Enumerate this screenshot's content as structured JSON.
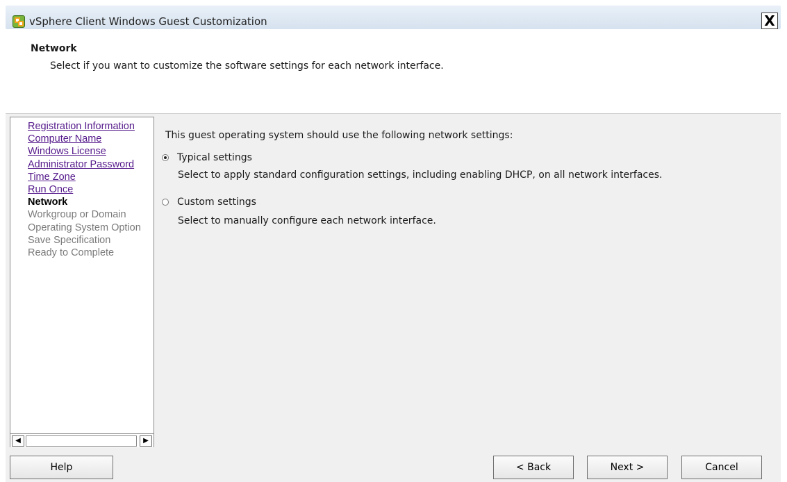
{
  "window": {
    "title": "vSphere Client Windows Guest Customization",
    "close_label": "X",
    "app_icon": "vsphere-icon"
  },
  "header": {
    "title": "Network",
    "description": "Select if you want to customize the software settings for each network interface."
  },
  "sidebar": {
    "steps": [
      {
        "label": "Registration Information",
        "state": "completed"
      },
      {
        "label": "Computer Name",
        "state": "completed"
      },
      {
        "label": "Windows License",
        "state": "completed"
      },
      {
        "label": "Administrator Password",
        "state": "completed"
      },
      {
        "label": "Time Zone",
        "state": "completed"
      },
      {
        "label": "Run Once",
        "state": "completed"
      },
      {
        "label": "Network",
        "state": "current"
      },
      {
        "label": "Workgroup or Domain",
        "state": "pending"
      },
      {
        "label": "Operating System Option",
        "state": "pending"
      },
      {
        "label": "Save Specification",
        "state": "pending"
      },
      {
        "label": "Ready to Complete",
        "state": "pending"
      }
    ],
    "scroll_left_icon": "◀",
    "scroll_right_icon": "▶"
  },
  "content": {
    "prompt": "This guest operating system should use the following network settings:",
    "options": [
      {
        "label": "Typical settings",
        "description": "Select to apply standard configuration settings, including enabling DHCP, on all network interfaces.",
        "selected": true
      },
      {
        "label": "Custom settings",
        "description": "Select to manually configure each network interface.",
        "selected": false
      }
    ]
  },
  "footer": {
    "help_label": "Help",
    "back_label": "< Back",
    "next_label": "Next >",
    "cancel_label": "Cancel"
  },
  "colors": {
    "visited_link": "#551a8b",
    "pending_step": "#7a7a7a",
    "panel_bg": "#f0f0f0"
  }
}
